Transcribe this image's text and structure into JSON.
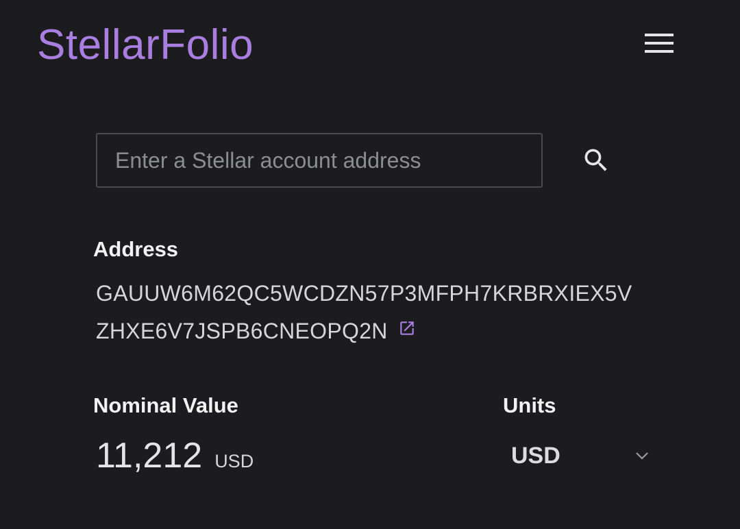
{
  "header": {
    "brand": "StellarFolio",
    "menu_icon": "hamburger-menu-icon"
  },
  "search": {
    "placeholder": "Enter a Stellar account address",
    "value": "",
    "icon": "search-icon"
  },
  "address": {
    "heading": "Address",
    "line1": "GAUUW6M62QC5WCDZN57P3MFPH7KRBRXIEX5V",
    "line2": "ZHXE6V7JSPB6CNEOPQ2N",
    "link_icon": "external-link-icon"
  },
  "nominal": {
    "heading": "Nominal Value",
    "amount": "11,212",
    "unit": "USD"
  },
  "units": {
    "heading": "Units",
    "selected": "USD",
    "icon": "chevron-down-icon"
  },
  "colors": {
    "background": "#1c1c1e",
    "brand_accent": "#a87fe0",
    "text": "#e9e9ea",
    "border": "#4a4b4f"
  }
}
